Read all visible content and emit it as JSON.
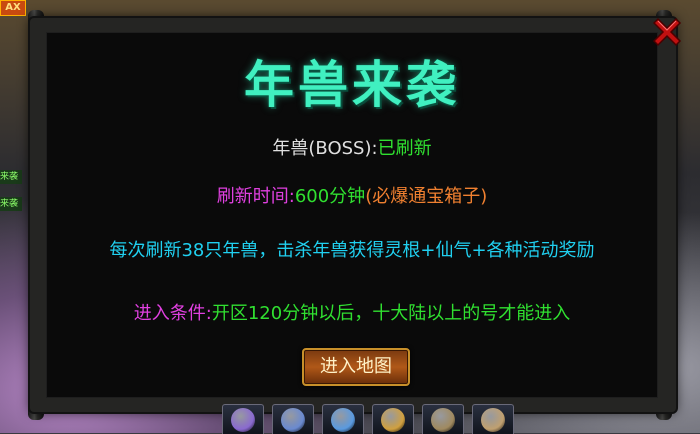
{
  "dialog": {
    "title": "年兽来袭",
    "boss_label": "年兽(BOSS):",
    "boss_status": "已刷新",
    "refresh_label": "刷新时间:",
    "refresh_value": "600分钟",
    "refresh_note": "(必爆通宝箱子)",
    "reward_text": "每次刷新38只年兽，击杀年兽获得灵根+仙气+各种活动奖励",
    "entry_label": "进入条件:",
    "entry_value": "开区120分钟以后，十大陆以上的号才能进入",
    "enter_button": "进入地图"
  },
  "background": {
    "corner_badge": "AX",
    "side_ribbon_1": "来袭",
    "side_ribbon_2": "来袭"
  },
  "skillbar": {
    "icons": [
      "skill-icon-1",
      "skill-icon-2",
      "skill-icon-3",
      "skill-icon-4",
      "skill-icon-5",
      "skill-icon-6"
    ],
    "colors": [
      "#8a6ad0",
      "#6a8ad0",
      "#5a9ae0",
      "#d0a040",
      "#a08a60",
      "#c0a070"
    ]
  }
}
